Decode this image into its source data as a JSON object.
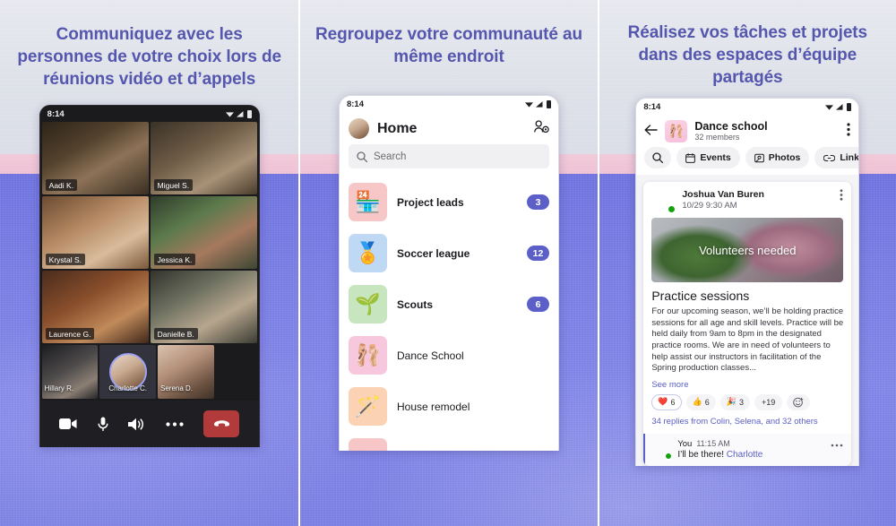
{
  "panels": [
    {
      "headline": "Communiquez avec les personnes de votre choix lors de réunions vidéo et d’appels",
      "status_time": "8:14"
    },
    {
      "headline": "Regroupez votre communauté au même endroit",
      "status_time": "8:14"
    },
    {
      "headline": "Réalisez vos tâches et projets dans des espaces d’équipe partagés",
      "status_time": "8:14"
    }
  ],
  "call": {
    "participants": [
      {
        "name": "Aadi K."
      },
      {
        "name": "Miguel S."
      },
      {
        "name": "Krystal S."
      },
      {
        "name": "Jessica K."
      },
      {
        "name": "Laurence G."
      },
      {
        "name": "Danielle B."
      }
    ],
    "strip": [
      {
        "name": "Hillary R.",
        "speaking": false
      },
      {
        "name": "Charlotte C.",
        "speaking": true
      },
      {
        "name": "Serena D.",
        "speaking": false
      },
      {
        "name": "",
        "speaking": false
      }
    ],
    "controls": [
      {
        "icon": "camera-icon",
        "label": "Camera"
      },
      {
        "icon": "microphone-icon",
        "label": "Microphone"
      },
      {
        "icon": "speaker-icon",
        "label": "Speaker"
      },
      {
        "icon": "more-icon",
        "label": "More"
      },
      {
        "icon": "hangup-icon",
        "label": "Hang up"
      }
    ],
    "hangup_color": "#b33a3a"
  },
  "home": {
    "title": "Home",
    "people_icon": "manage-people-icon",
    "search_placeholder": "Search",
    "items": [
      {
        "name": "Project leads",
        "emoji": "🏪",
        "badge": "3",
        "bold": true,
        "tint": "#f7c6c6"
      },
      {
        "name": "Soccer league",
        "emoji": "🏅",
        "badge": "12",
        "bold": true,
        "tint": "#bfd9f5"
      },
      {
        "name": "Scouts",
        "emoji": "🌱",
        "badge": "6",
        "bold": true,
        "tint": "#c7e6bf"
      },
      {
        "name": "Dance School",
        "emoji": "🩰",
        "badge": "",
        "bold": false,
        "tint": "#f7c8dd"
      },
      {
        "name": "House remodel",
        "emoji": "🪄",
        "badge": "",
        "bold": false,
        "tint": "#fbd3b4"
      }
    ],
    "badge_color": "#5b5fc7"
  },
  "channel": {
    "back_icon": "back-arrow-icon",
    "icon_emoji": "🩰",
    "name": "Dance school",
    "members": "32 members",
    "overflow_icon": "more-vertical-icon",
    "chips": [
      {
        "label": "",
        "icon": "search-icon"
      },
      {
        "label": "Events",
        "icon": "calendar-icon"
      },
      {
        "label": "Photos",
        "icon": "photo-icon"
      },
      {
        "label": "Links",
        "icon": "link-icon"
      }
    ],
    "post": {
      "author": "Joshua Van Buren",
      "timestamp": "10/29 9:30 AM",
      "overflow_icon": "more-vertical-icon",
      "banner_caption": "Volunteers needed",
      "title": "Practice sessions",
      "body": "For our upcoming season, we’ll be holding practice sessions for all age and skill levels. Practice will be held daily from 9am to 8pm in the designated practice rooms. We are in need of volunteers to help assist our instructors in facilitation of the Spring production classes...",
      "see_more": "See more",
      "reactions": [
        {
          "emoji": "❤️",
          "count": "6"
        },
        {
          "emoji": "👍",
          "count": "6"
        },
        {
          "emoji": "🎉",
          "count": "3"
        },
        {
          "emoji": "",
          "count": "+19"
        }
      ],
      "add_reaction_icon": "add-reaction-icon",
      "replies_summary": "34 replies from Colin, Selena, and 32 others"
    },
    "reply": {
      "author": "You",
      "timestamp": "11:15 AM",
      "text": "I’ll be there! ",
      "mention": "Charlotte",
      "overflow_icon": "more-horizontal-icon"
    }
  }
}
